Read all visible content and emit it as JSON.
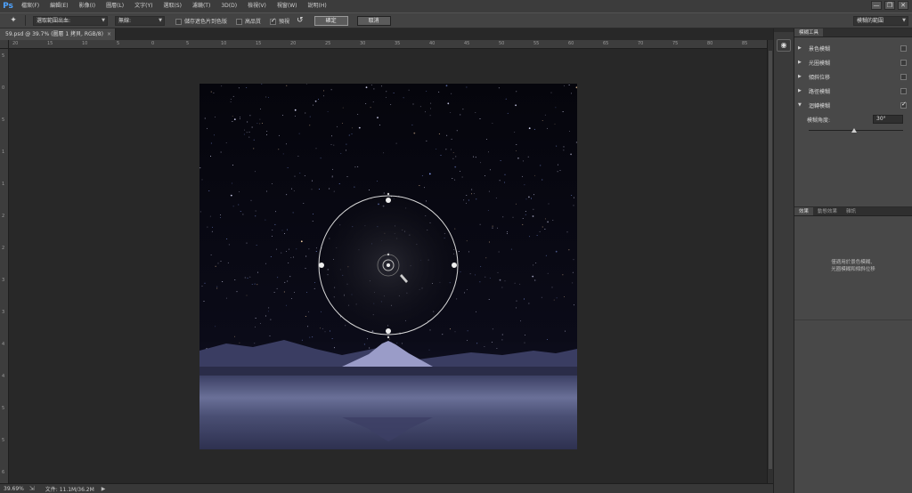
{
  "app": {
    "logo": "Ps"
  },
  "menubar": {
    "items": [
      "檔案(F)",
      "編輯(E)",
      "影像(I)",
      "圖層(L)",
      "文字(Y)",
      "選取(S)",
      "濾鏡(T)",
      "3D(D)",
      "檢視(V)",
      "視窗(W)",
      "說明(H)"
    ],
    "window_controls": [
      "—",
      "❐",
      "✕"
    ]
  },
  "options_bar": {
    "tool_icon": "pin-tool-icon",
    "output_select": "選取範圍出血:",
    "mode_select": "無線:",
    "save_mask_label": "儲存遮色片到色版",
    "high_quality_label": "高品質",
    "preview_label": "預視",
    "reset_icon": "undo-arrow-icon",
    "ok_label": "確定",
    "cancel_label": "取消",
    "workspace_select": "模糊的範圍"
  },
  "document": {
    "tab_title": "59.psd @ 39.7% (圖層 1 拷貝, RGB/8)",
    "tab_close": "×"
  },
  "rulers": {
    "h_labels": [
      "20",
      "15",
      "10",
      "5",
      "0",
      "5",
      "10",
      "15",
      "20",
      "25",
      "30",
      "35",
      "40",
      "45",
      "50",
      "55",
      "60",
      "65",
      "70",
      "75",
      "80",
      "85"
    ],
    "v_labels": [
      "5",
      "0",
      "5",
      "1",
      "1",
      "2",
      "2",
      "3",
      "3",
      "4",
      "4",
      "5",
      "5",
      "6"
    ]
  },
  "status": {
    "zoom": "39.69%",
    "doc_info": "文件: 11.1M/36.2M",
    "arrow": "▶"
  },
  "blur_tools_panel": {
    "tab": "模糊工具",
    "rows": [
      {
        "name": "景色模糊",
        "expanded": false,
        "checked": false
      },
      {
        "name": "光圈模糊",
        "expanded": false,
        "checked": false
      },
      {
        "name": "傾斜位移",
        "expanded": false,
        "checked": false
      },
      {
        "name": "路徑模糊",
        "expanded": false,
        "checked": false
      },
      {
        "name": "迴轉模糊",
        "expanded": true,
        "checked": true
      }
    ],
    "angle_label": "模糊角度:",
    "angle_value": "30°",
    "slider_fraction": 0.48
  },
  "effects_panel": {
    "tabs": [
      "效果",
      "動態效果",
      "雜訊"
    ],
    "message_line1": "僅適用於景色模糊、",
    "message_line2": "光圈模糊和傾斜位移"
  },
  "colors": {
    "accent": "#4ea3ff",
    "panel_bg": "#484848",
    "sky": "#07070e",
    "water": "#545a80"
  }
}
